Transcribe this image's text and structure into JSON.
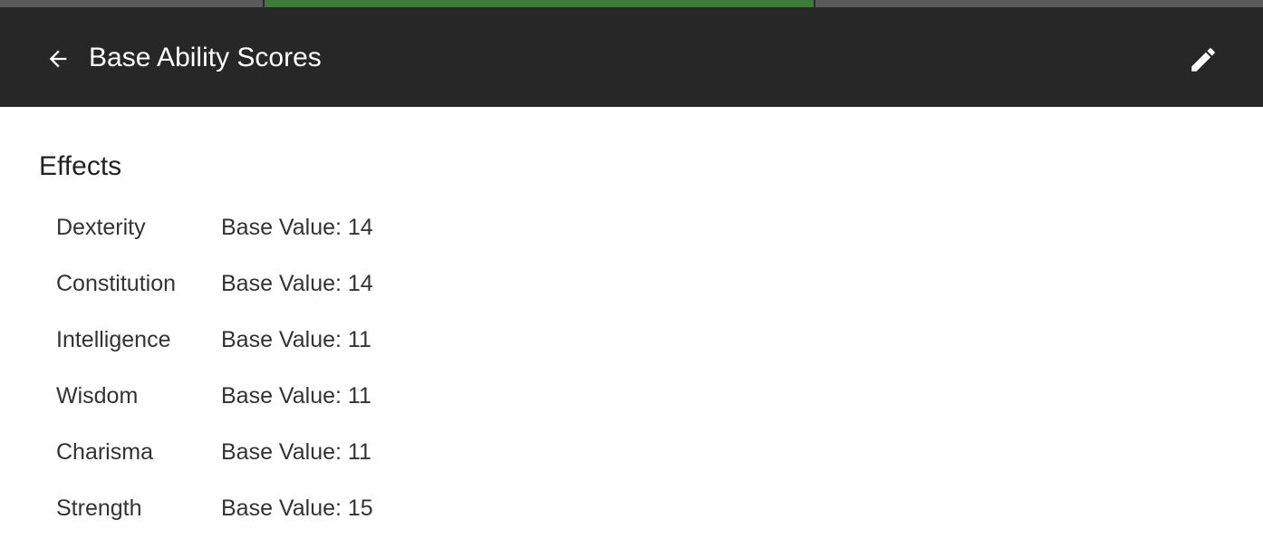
{
  "app_bar": {
    "title": "Base Ability Scores",
    "back_icon": "arrow-left-icon",
    "edit_icon": "pencil-icon",
    "background": "#272727"
  },
  "effects": {
    "heading": "Effects",
    "items": [
      {
        "name": "Dexterity",
        "value": "Base Value: 14"
      },
      {
        "name": "Constitution",
        "value": "Base Value: 14"
      },
      {
        "name": "Intelligence",
        "value": "Base Value: 11"
      },
      {
        "name": "Wisdom",
        "value": "Base Value: 11"
      },
      {
        "name": "Charisma",
        "value": "Base Value: 11"
      },
      {
        "name": "Strength",
        "value": "Base Value: 15"
      }
    ]
  }
}
